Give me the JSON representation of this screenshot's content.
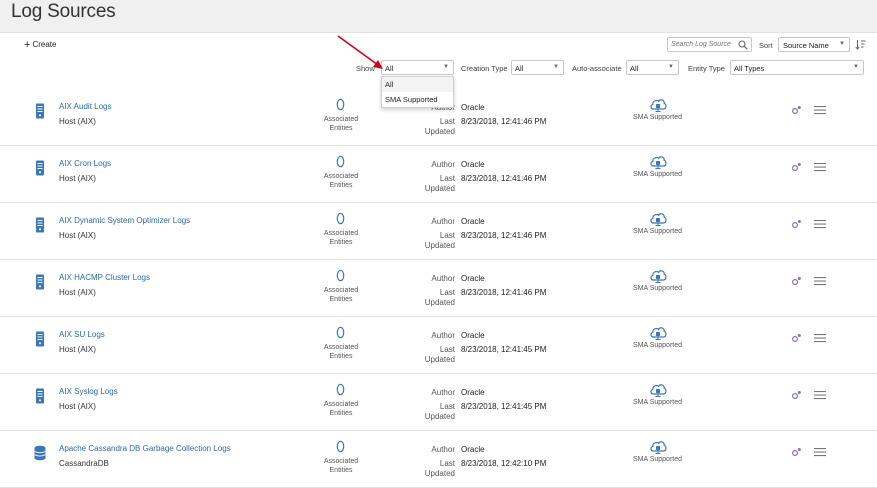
{
  "header": {
    "title": "Log Sources"
  },
  "toolbar": {
    "create_label": "Create",
    "search_placeholder": "Search Log Source",
    "sort_label": "Sort",
    "sort_value": "Source Name"
  },
  "filters": {
    "show_label": "Show",
    "show_value": "All",
    "creation_type_label": "Creation Type",
    "creation_type_value": "All",
    "auto_associate_label": "Auto-associate",
    "auto_associate_value": "All",
    "entity_type_label": "Entity Type",
    "entity_type_value": "All Types"
  },
  "show_dropdown": {
    "options": [
      "All",
      "SMA Supported"
    ]
  },
  "labels": {
    "associated": "Associated",
    "entities": "Entities",
    "author": "Author",
    "last": "Last",
    "updated": "Updated",
    "sma_supported": "SMA Supported"
  },
  "colors": {
    "accent": "#2a6aa8",
    "icon_blue": "#3a78b8",
    "arrow": "#d0021b"
  },
  "rows": [
    {
      "name": "AIX Audit Logs",
      "entity_type": "Host (AIX)",
      "author": "Oracle",
      "updated": "8/23/2018, 12:41:46 PM",
      "icon": "server-icon"
    },
    {
      "name": "AIX Cron Logs",
      "entity_type": "Host (AIX)",
      "author": "Oracle",
      "updated": "8/23/2018, 12:41:46 PM",
      "icon": "server-icon"
    },
    {
      "name": "AIX Dynamic System Optimizer Logs",
      "entity_type": "Host (AIX)",
      "author": "Oracle",
      "updated": "8/23/2018, 12:41:46 PM",
      "icon": "server-icon"
    },
    {
      "name": "AIX HACMP Cluster Logs",
      "entity_type": "Host (AIX)",
      "author": "Oracle",
      "updated": "8/23/2018, 12:41:46 PM",
      "icon": "server-icon"
    },
    {
      "name": "AIX SU Logs",
      "entity_type": "Host (AIX)",
      "author": "Oracle",
      "updated": "8/23/2018, 12:41:45 PM",
      "icon": "server-icon"
    },
    {
      "name": "AIX Syslog Logs",
      "entity_type": "Host (AIX)",
      "author": "Oracle",
      "updated": "8/23/2018, 12:41:45 PM",
      "icon": "server-icon"
    },
    {
      "name": "Apache Cassandra DB Garbage Collection Logs",
      "entity_type": "CassandraDB",
      "author": "Oracle",
      "updated": "8/23/2018, 12:42:10 PM",
      "icon": "database-icon"
    }
  ]
}
